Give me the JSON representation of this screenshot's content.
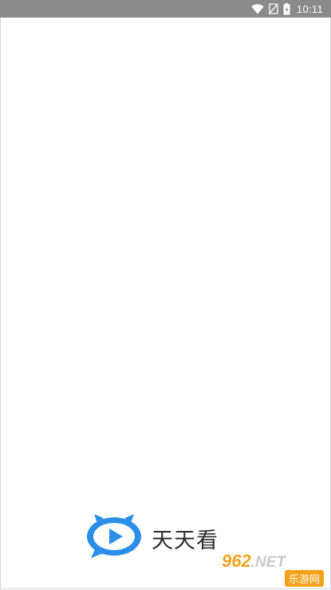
{
  "status_bar": {
    "time": "10:11",
    "icons": [
      "wifi-icon",
      "no-sim-icon",
      "battery-charging-icon"
    ]
  },
  "splash": {
    "app_name": "天天看",
    "logo_icon": "tv-play-bubble-icon",
    "logo_color": "#2b8fe8"
  },
  "watermark": {
    "main_digits": "962",
    "main_suffix": ".NET",
    "sub_text": "乐游网",
    "accent_color": "#f5a21b"
  }
}
